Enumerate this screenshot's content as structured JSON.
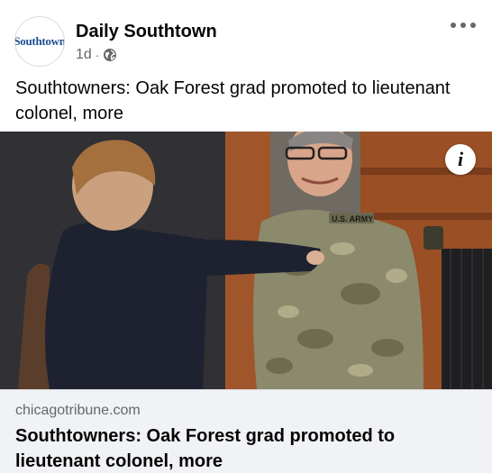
{
  "post": {
    "page_name": "Daily Southtown",
    "avatar_text": "Southtown",
    "timestamp": "1d",
    "separator": "·",
    "privacy_icon": "globe-icon",
    "text": "Southtowners: Oak Forest grad promoted to lieutenant colonel, more"
  },
  "link": {
    "domain": "chicagotribune.com",
    "title": "Southtowners: Oak Forest grad promoted to lieutenant colonel, more",
    "info_icon": "i",
    "image_name_tape": "U.S. ARMY"
  },
  "colors": {
    "text_primary": "#050505",
    "text_secondary": "#65676b",
    "footer_bg": "#f0f2f5",
    "brand_blue": "#1d4f91"
  }
}
